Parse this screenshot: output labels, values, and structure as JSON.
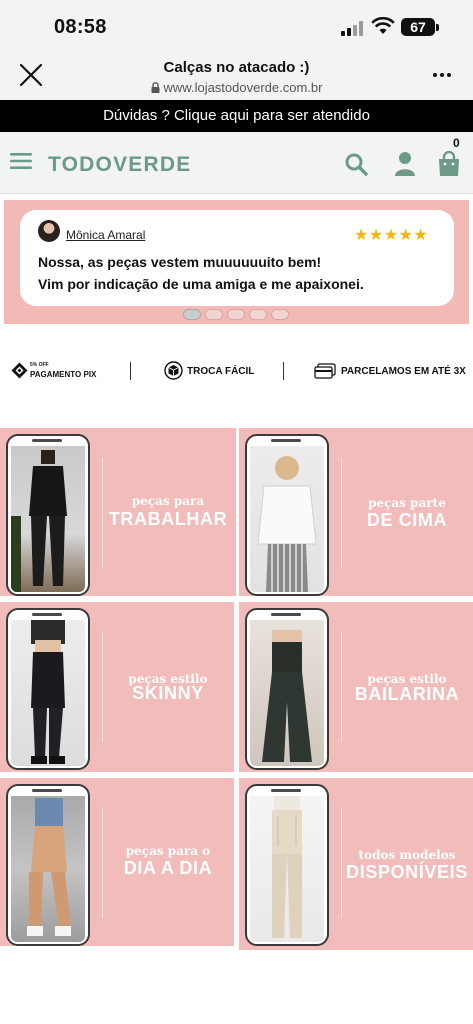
{
  "status_bar": {
    "time": "08:58",
    "battery": "67"
  },
  "browser": {
    "title": "Calças no atacado :)",
    "url": "www.lojastodoverde.com.br"
  },
  "promo": {
    "text": "Dúvidas ? Clique aqui para ser atendido"
  },
  "store": {
    "logo": "TODOVERDE",
    "cart_count": "0"
  },
  "testimonial": {
    "name": "Mônica Amaral",
    "stars": "★★★★★",
    "line1": "Nossa, as peças vestem muuuuuuito bem!",
    "line2": "Vim por indicação de uma amiga e me apaixonei.",
    "slides": 5,
    "active_slide": 1
  },
  "benefits": {
    "pix_small": "5% OFF",
    "pix": "PAGAMENTO PIX",
    "troca": "TROCA FÁCIL",
    "parcelas": "PARCELAMOS EM ATÉ 3X"
  },
  "categories": [
    {
      "small": "peças para",
      "big": "TRABALHAR"
    },
    {
      "small": "peças parte",
      "big": "DE CIMA"
    },
    {
      "small": "peças estilo",
      "big": "SKINNY"
    },
    {
      "small": "peças estilo",
      "big": "BAILARINA"
    },
    {
      "small": "peças para o",
      "big": "DIA A DIA"
    },
    {
      "small": "todos modelos",
      "big": "DISPONÍVEIS"
    }
  ],
  "colors": {
    "brand": "#6c9a86",
    "pink": "#f2bcbb",
    "star": "#f6b40c"
  },
  "icons": [
    "close-icon",
    "lock-icon",
    "more-icon",
    "menu-icon",
    "search-icon",
    "user-icon",
    "bag-icon",
    "pix-icon",
    "box-icon",
    "card-icon"
  ]
}
